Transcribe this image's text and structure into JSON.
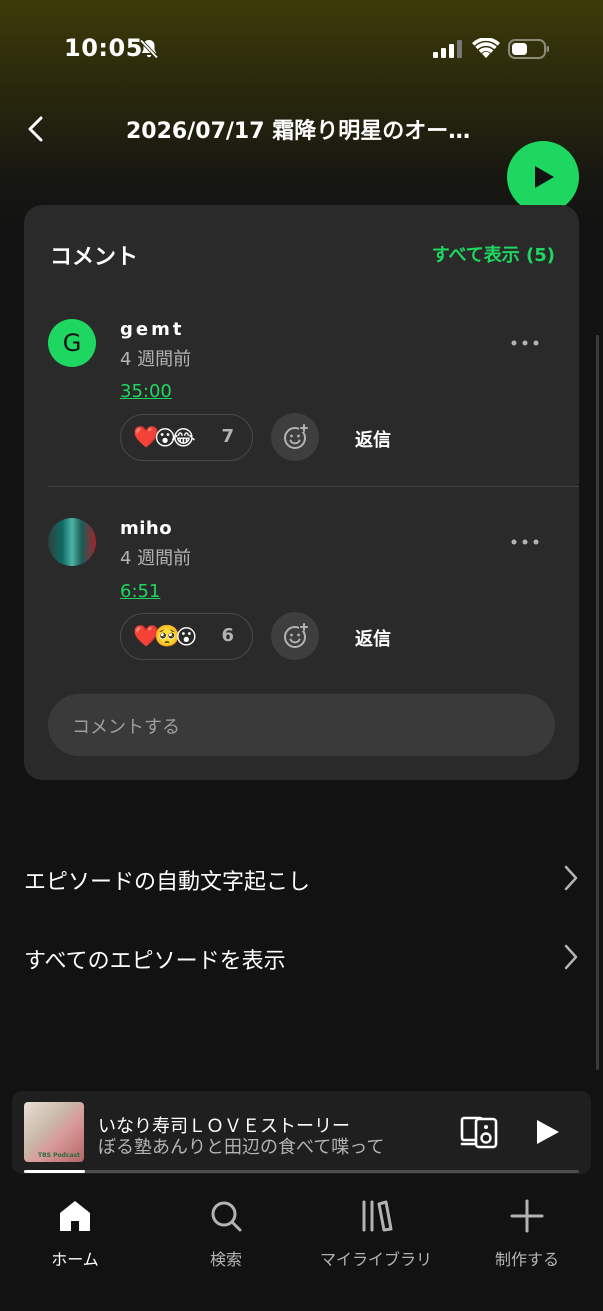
{
  "status_bar": {
    "time": "10:05"
  },
  "header": {
    "title": "2026/07/17 霜降り明星のオー…"
  },
  "comments": {
    "title": "コメント",
    "see_all": "すべて表示 (5)",
    "items": [
      {
        "username": "gemt",
        "avatar_letter": "G",
        "ago": "4 週間前",
        "timestamp": "35:00",
        "emojis": [
          "❤️",
          "😮",
          "😂"
        ],
        "reaction_count": "7",
        "reply_label": "返信"
      },
      {
        "username": "miho",
        "ago": "4 週間前",
        "timestamp": "6:51",
        "emojis": [
          "❤️",
          "🥺",
          "😮"
        ],
        "reaction_count": "6",
        "reply_label": "返信"
      }
    ],
    "input_placeholder": "コメントする"
  },
  "links": [
    {
      "label": "エピソードの自動文字起こし"
    },
    {
      "label": "すべてのエピソードを表示"
    }
  ],
  "now_playing": {
    "title": "いなり寿司ＬＯＶＥストーリー",
    "artist": "ぼる塾あんりと田辺の食べて喋って",
    "cover_text": "TBS Podcast",
    "progress_percent": 11
  },
  "bottom_nav": {
    "items": [
      {
        "label": "ホーム",
        "icon": "home-icon",
        "active": true
      },
      {
        "label": "検索",
        "icon": "search-icon",
        "active": false
      },
      {
        "label": "マイライブラリ",
        "icon": "library-icon",
        "active": false
      },
      {
        "label": "制作する",
        "icon": "plus-icon",
        "active": false
      }
    ]
  },
  "colors": {
    "accent": "#1ed760",
    "background": "#121212",
    "card": "#2a2a2a"
  }
}
